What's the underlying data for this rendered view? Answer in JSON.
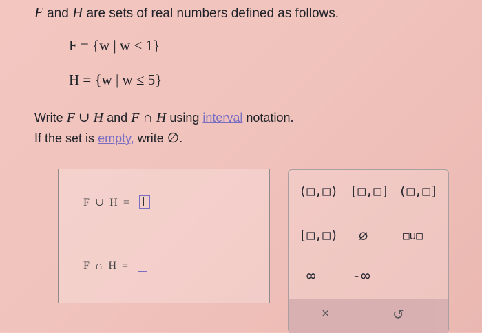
{
  "intro": {
    "var_F": "F",
    "and": "and",
    "var_H": "H",
    "rest": "are sets of real numbers defined as follows."
  },
  "defs": {
    "F": "F = {w | w < 1}",
    "H": "H = {w | w ≤ 5}"
  },
  "instructions": {
    "write": "Write",
    "union_expr": "F ∪ H",
    "and": "and",
    "intersect_expr": "F ∩ H",
    "using": "using",
    "interval_link": "interval",
    "notation": "notation.",
    "line2_pre": "If the set is",
    "empty_link": "empty,",
    "line2_mid": "write",
    "empty_symbol": "∅",
    "period": "."
  },
  "answers": {
    "union_label": "F ∪ H =",
    "intersect_label": "F ∩ H ="
  },
  "palette": {
    "open_interval": "(□,□)",
    "closed_interval": "[□,□]",
    "left_open_interval": "(□,□]",
    "right_open_interval": "[□,□)",
    "empty_set": "∅",
    "union": "□∪□",
    "infinity": "∞",
    "neg_infinity": "-∞",
    "clear": "×",
    "undo": "↺"
  },
  "colors": {
    "link": "#7a6ec2",
    "background": "#f1c3bd"
  }
}
